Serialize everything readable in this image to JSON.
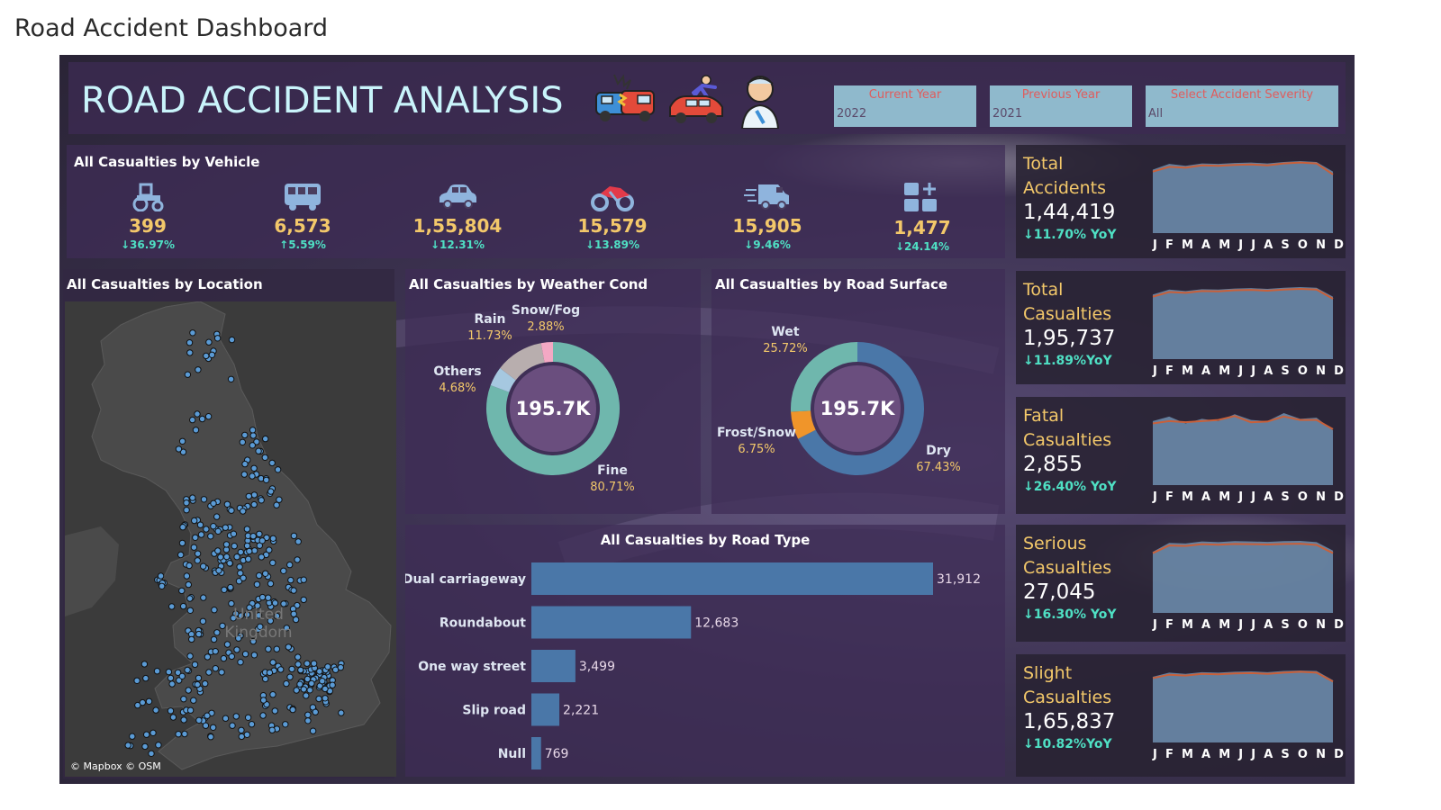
{
  "page_title": "Road Accident Dashboard",
  "header": {
    "title": "ROAD ACCIDENT ANALYSIS",
    "icons": [
      "car-crash-icon",
      "pedestrian-hit-icon",
      "injured-person-icon"
    ],
    "filters": [
      {
        "label": "Current Year",
        "value": "2022"
      },
      {
        "label": "Previous Year",
        "value": "2021"
      },
      {
        "label": "Select Accident Severity",
        "value": "All"
      }
    ]
  },
  "vehicles": {
    "title": "All Casualties by Vehicle",
    "items": [
      {
        "icon": "tractor-icon",
        "value": "399",
        "change": "↓36.97%"
      },
      {
        "icon": "bus-icon",
        "value": "6,573",
        "change": "↑5.59%"
      },
      {
        "icon": "car-icon",
        "value": "1,55,804",
        "change": "↓12.31%"
      },
      {
        "icon": "motorcycle-icon",
        "value": "15,579",
        "change": "↓13.89%"
      },
      {
        "icon": "van-icon",
        "value": "15,905",
        "change": "↓9.46%"
      },
      {
        "icon": "others-icon",
        "value": "1,477",
        "change": "↓24.14%"
      }
    ]
  },
  "location": {
    "title": "All Casualties by Location",
    "map_label": "United Kingdom",
    "attribution": "© Mapbox © OSM"
  },
  "colors": {
    "accent_gold": "#f3c86a",
    "accent_teal": "#4fe0c4",
    "bar_blue": "#4a77a8",
    "donut_fine": "#6fb7ad",
    "donut_dry": "#4a77a8",
    "donut_frost": "#f0952a",
    "donut_center": "#6a4e7e"
  },
  "chart_data": [
    {
      "type": "pie",
      "title": "All Casualties by Weather Cond",
      "center_label": "195.7K",
      "slices": [
        {
          "label": "Fine",
          "pct_label": "80.71%",
          "value": 80.71,
          "color": "#6fb7ad"
        },
        {
          "label": "Others",
          "pct_label": "4.68%",
          "value": 4.68,
          "color": "#a6c8e0"
        },
        {
          "label": "Rain",
          "pct_label": "11.73%",
          "value": 11.73,
          "color": "#b8aeae"
        },
        {
          "label": "Snow/Fog",
          "pct_label": "2.88%",
          "value": 2.88,
          "color": "#f4a8c4"
        }
      ]
    },
    {
      "type": "pie",
      "title": "All  Casualties by Road Surface",
      "center_label": "195.7K",
      "slices": [
        {
          "label": "Dry",
          "pct_label": "67.43%",
          "value": 67.43,
          "color": "#4a77a8"
        },
        {
          "label": "Frost/Snow",
          "pct_label": "6.75%",
          "value": 6.75,
          "color": "#f0952a"
        },
        {
          "label": "Wet",
          "pct_label": "25.72%",
          "value": 25.72,
          "color": "#6fb7ad"
        }
      ]
    },
    {
      "type": "bar",
      "title": "All Casualties by Road Type",
      "categories": [
        "Dual carriageway",
        "Roundabout",
        "One way street",
        "Slip road",
        "Null"
      ],
      "values": [
        31912,
        12683,
        3499,
        2221,
        769
      ],
      "value_labels": [
        "31,912",
        "12,683",
        "3,499",
        "2,221",
        "769"
      ]
    },
    {
      "type": "area",
      "title": "Total Accidents",
      "value": "1,44,419",
      "change": "↓11.70% YoY",
      "x": [
        "J",
        "F",
        "M",
        "A",
        "M",
        "J",
        "J",
        "A",
        "S",
        "O",
        "N",
        "D"
      ],
      "current": [
        11400,
        12600,
        12200,
        12700,
        12600,
        12800,
        12900,
        12700,
        13000,
        13200,
        13000,
        11000
      ],
      "previous": [
        11000,
        12000,
        11800,
        12300,
        12200,
        12400,
        12500,
        12300,
        12700,
        12900,
        12700,
        10400
      ]
    },
    {
      "type": "area",
      "title": "Total Casualties",
      "value": "1,95,737",
      "change": "↓11.89%YoY",
      "x": [
        "J",
        "F",
        "M",
        "A",
        "M",
        "J",
        "J",
        "A",
        "S",
        "O",
        "N",
        "D"
      ],
      "current": [
        15600,
        17000,
        16600,
        17100,
        17000,
        17300,
        17400,
        17200,
        17500,
        17700,
        17500,
        15000
      ],
      "previous": [
        15000,
        16300,
        16100,
        16600,
        16500,
        16800,
        16900,
        16700,
        17000,
        17200,
        17000,
        14400
      ]
    },
    {
      "type": "area",
      "title": "Fatal Casualties",
      "value": "2,855",
      "change": "↓26.40% YoY",
      "x": [
        "J",
        "F",
        "M",
        "A",
        "M",
        "J",
        "J",
        "A",
        "S",
        "O",
        "N",
        "D"
      ],
      "current": [
        240,
        260,
        230,
        250,
        240,
        270,
        245,
        240,
        275,
        250,
        255,
        200
      ],
      "previous": [
        230,
        240,
        235,
        240,
        245,
        262,
        235,
        238,
        260,
        245,
        245,
        205
      ]
    },
    {
      "type": "area",
      "title": "Serious Casualties",
      "value": "27,045",
      "change": "↓16.30% YoY",
      "x": [
        "J",
        "F",
        "M",
        "A",
        "M",
        "J",
        "J",
        "A",
        "S",
        "O",
        "N",
        "D"
      ],
      "current": [
        2050,
        2400,
        2380,
        2460,
        2430,
        2470,
        2460,
        2440,
        2470,
        2480,
        2430,
        2100
      ],
      "previous": [
        2000,
        2300,
        2280,
        2350,
        2330,
        2360,
        2350,
        2340,
        2360,
        2370,
        2320,
        2000
      ]
    },
    {
      "type": "area",
      "title": "Slight Casualties",
      "value": "1,65,837",
      "change": "↓10.82%YoY",
      "x": [
        "J",
        "F",
        "M",
        "A",
        "M",
        "J",
        "J",
        "A",
        "S",
        "O",
        "N",
        "D"
      ],
      "current": [
        13400,
        14400,
        14100,
        14500,
        14400,
        14600,
        14700,
        14500,
        14800,
        14900,
        14800,
        12600
      ],
      "previous": [
        13100,
        13900,
        13700,
        14100,
        14000,
        14200,
        14300,
        14100,
        14400,
        14600,
        14400,
        12300
      ]
    }
  ]
}
